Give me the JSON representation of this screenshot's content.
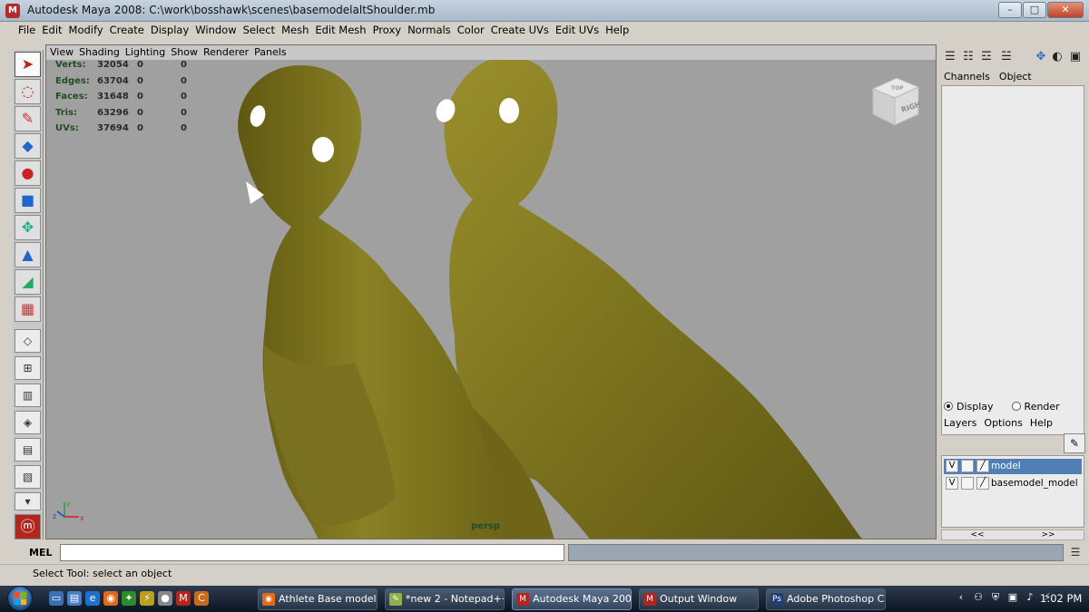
{
  "window": {
    "title": "Autodesk Maya 2008: C:\\work\\bosshawk\\scenes\\basemodelaltShoulder.mb",
    "app_icon": "maya-icon",
    "buttons": {
      "minimize": "–",
      "maximize": "□",
      "close": "✕"
    }
  },
  "menubar": [
    "File",
    "Edit",
    "Modify",
    "Create",
    "Display",
    "Window",
    "Select",
    "Mesh",
    "Edit Mesh",
    "Proxy",
    "Normals",
    "Color",
    "Create UVs",
    "Edit UVs",
    "Help"
  ],
  "panel_menu": [
    "View",
    "Shading",
    "Lighting",
    "Show",
    "Renderer",
    "Panels"
  ],
  "hud": [
    {
      "label": "Verts:",
      "values": [
        "32054",
        "0",
        "0"
      ]
    },
    {
      "label": "Edges:",
      "values": [
        "63704",
        "0",
        "0"
      ]
    },
    {
      "label": "Faces:",
      "values": [
        "31648",
        "0",
        "0"
      ]
    },
    {
      "label": "Tris:",
      "values": [
        "63296",
        "0",
        "0"
      ]
    },
    {
      "label": "UVs:",
      "values": [
        "37694",
        "0",
        "0"
      ]
    }
  ],
  "viewcube": {
    "face_right": "RIGHT",
    "face_top": "TOP"
  },
  "camera_label": "persp",
  "axis": {
    "x": "x",
    "y": "y",
    "z": "z"
  },
  "channel_box": {
    "tabs": [
      "Channels",
      "Object"
    ]
  },
  "layer_editor": {
    "display_label": "Display",
    "render_label": "Render",
    "menu": [
      "Layers",
      "Options",
      "Help"
    ],
    "layers": [
      {
        "visibility": "V",
        "name": "model",
        "selected": true
      },
      {
        "visibility": "V",
        "name": "basemodel_model",
        "selected": false
      }
    ],
    "scroll_left": "<<",
    "scroll_right": ">>"
  },
  "command_line": {
    "label": "MEL",
    "value": ""
  },
  "help_line": "Select Tool: select an object",
  "taskbar": {
    "tasks": [
      {
        "label": "Athlete Base model ...",
        "icon": "firefox-icon",
        "active": false
      },
      {
        "label": "*new  2 - Notepad++",
        "icon": "notepad-icon",
        "active": false
      },
      {
        "label": "Autodesk Maya 200...",
        "icon": "maya-icon",
        "active": true
      },
      {
        "label": "Output Window",
        "icon": "maya-icon",
        "active": false
      },
      {
        "label": "Adobe Photoshop C...",
        "icon": "photoshop-icon",
        "active": false
      }
    ],
    "clock": "1:02 PM"
  },
  "colors": {
    "viewport_bg": "#a0a0a0",
    "model_skin": "#7d7420",
    "layer_selected": "#4f7fb5",
    "taskbar": "#1a2535"
  }
}
